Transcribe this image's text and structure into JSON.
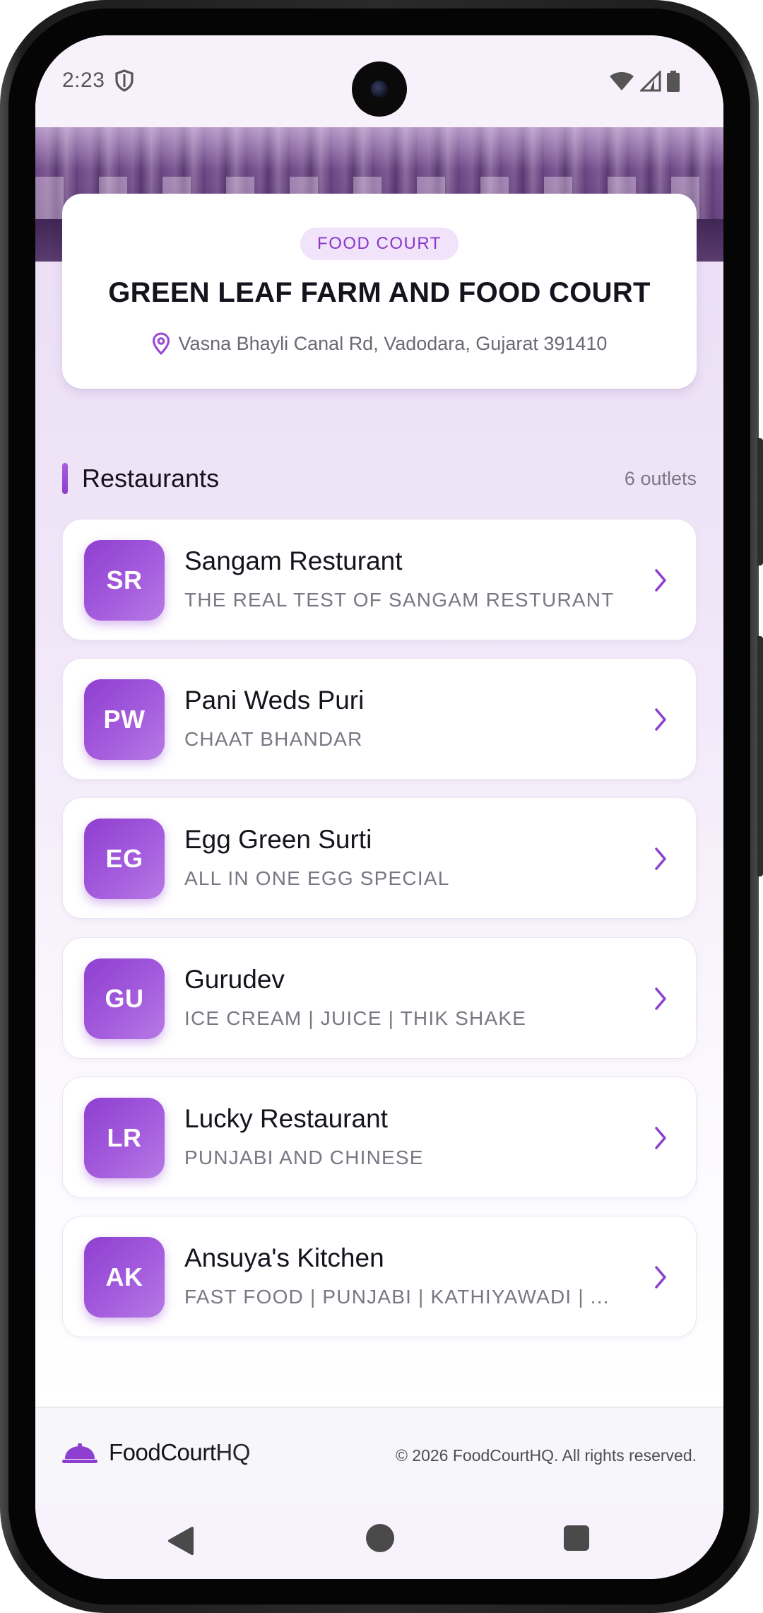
{
  "status_bar": {
    "time": "2:23",
    "icons": [
      "shield-icon",
      "wifi-icon",
      "signal-icon",
      "battery-icon"
    ]
  },
  "venue": {
    "category": "FOOD COURT",
    "name": "GREEN LEAF FARM AND FOOD COURT",
    "address": "Vasna Bhayli Canal Rd, Vadodara, Gujarat 391410"
  },
  "restaurants_section": {
    "title": "Restaurants",
    "count_label": "6 outlets",
    "items": [
      {
        "initials": "SR",
        "name": "Sangam Resturant",
        "subtitle": "THE REAL TEST OF SANGAM RESTURANT"
      },
      {
        "initials": "PW",
        "name": "Pani Weds Puri",
        "subtitle": "CHAAT BHANDAR"
      },
      {
        "initials": "EG",
        "name": "Egg Green Surti",
        "subtitle": "ALL IN ONE EGG SPECIAL"
      },
      {
        "initials": "GU",
        "name": "Gurudev",
        "subtitle": "ICE CREAM | JUICE | THIK SHAKE"
      },
      {
        "initials": "LR",
        "name": "Lucky Restaurant",
        "subtitle": "PUNJABI AND CHINESE"
      },
      {
        "initials": "AK",
        "name": "Ansuya's Kitchen",
        "subtitle": "FAST FOOD | PUNJABI | KATHIYAWADI | ..."
      }
    ]
  },
  "footer": {
    "brand_main": "FoodCourt",
    "brand_suffix": "HQ",
    "copyright": "© 2026 FoodCourtHQ. All rights reserved."
  },
  "colors": {
    "accent": "#8e3fd0",
    "accent_light": "#f1e3fa",
    "text_primary": "#16131d",
    "text_secondary": "#7a7683"
  }
}
